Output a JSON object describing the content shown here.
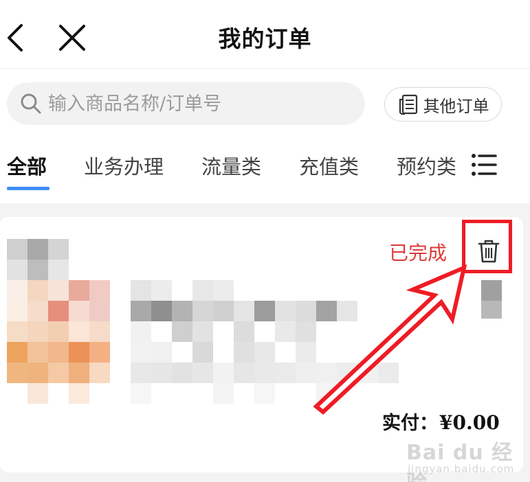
{
  "header": {
    "title": "我的订单",
    "back_icon": "chevron-left-icon",
    "close_icon": "close-icon"
  },
  "search": {
    "placeholder": "输入商品名称/订单号",
    "icon": "search-icon"
  },
  "other_orders": {
    "label": "其他订单",
    "icon": "receipt-icon"
  },
  "tabs": [
    {
      "label": "全部",
      "active": true
    },
    {
      "label": "业务办理",
      "active": false
    },
    {
      "label": "流量类",
      "active": false
    },
    {
      "label": "充值类",
      "active": false
    },
    {
      "label": "预约类",
      "active": false
    }
  ],
  "tabs_more_icon": "list-icon",
  "order": {
    "status": "已完成",
    "delete_icon": "trash-icon",
    "paid_label": "实付：",
    "paid_amount": "¥0.00"
  },
  "watermark": {
    "logo": "Bai du 经验",
    "sub": "jingyan.baidu.com"
  },
  "colors": {
    "accent_blue": "#3e8ef7",
    "status_red": "#e03a3a",
    "annotation_red": "#ee1c25",
    "search_bg": "#f2f2f2",
    "page_band": "#f3f3f3"
  }
}
